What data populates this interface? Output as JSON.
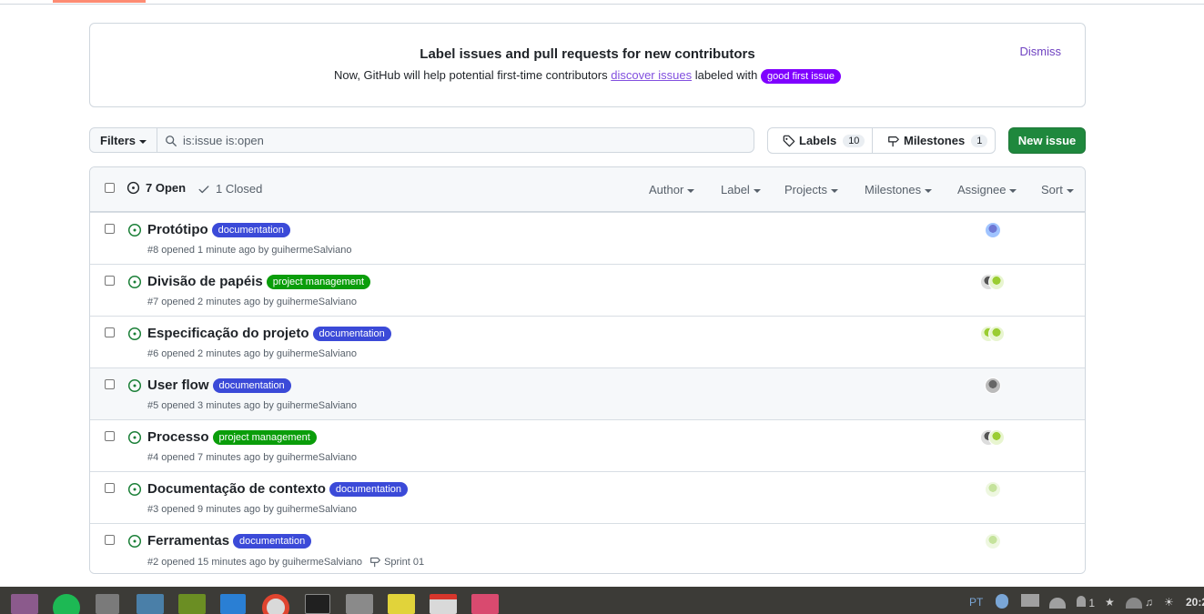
{
  "banner": {
    "title": "Label issues and pull requests for new contributors",
    "text_before": "Now, GitHub will help potential first-time contributors ",
    "link": "discover issues",
    "text_after": " labeled with ",
    "badge": "good first issue",
    "dismiss": "Dismiss"
  },
  "toolbar": {
    "filters": "Filters",
    "search_value": "is:issue is:open",
    "labels": "Labels",
    "labels_count": "10",
    "milestones": "Milestones",
    "milestones_count": "1",
    "new_issue": "New issue"
  },
  "list_header": {
    "open": "7 Open",
    "closed": "1 Closed",
    "author": "Author",
    "label": "Label",
    "projects": "Projects",
    "milestones": "Milestones",
    "assignee": "Assignee",
    "sort": "Sort"
  },
  "colors": {
    "documentation": "#3b4ad8",
    "project_management": "#0a9d0a",
    "good_first_issue": "#7f00ff",
    "open_icon": "#1a7f37",
    "new_issue": "#1f883d"
  },
  "issues": [
    {
      "title": "Protótipo",
      "label": "documentation",
      "meta": "#8 opened 1 minute ago by guihermeSalviano",
      "milestone": ""
    },
    {
      "title": "Divisão de papéis",
      "label": "project management",
      "meta": "#7 opened 2 minutes ago by guihermeSalviano",
      "milestone": ""
    },
    {
      "title": "Especificação do projeto",
      "label": "documentation",
      "meta": "#6 opened 2 minutes ago by guihermeSalviano",
      "milestone": ""
    },
    {
      "title": "User flow",
      "label": "documentation",
      "meta": "#5 opened 3 minutes ago by guihermeSalviano",
      "milestone": ""
    },
    {
      "title": "Processo",
      "label": "project management",
      "meta": "#4 opened 7 minutes ago by guihermeSalviano",
      "milestone": ""
    },
    {
      "title": "Documentação de contexto",
      "label": "documentation",
      "meta": "#3 opened 9 minutes ago by guihermeSalviano",
      "milestone": ""
    },
    {
      "title": "Ferramentas",
      "label": "documentation",
      "meta": "#2 opened 15 minutes ago by guihermeSalviano",
      "milestone": "Sprint 01"
    }
  ],
  "taskbar": {
    "keyboard_layout": "PT",
    "notifications": "1",
    "clock": "20:2"
  }
}
